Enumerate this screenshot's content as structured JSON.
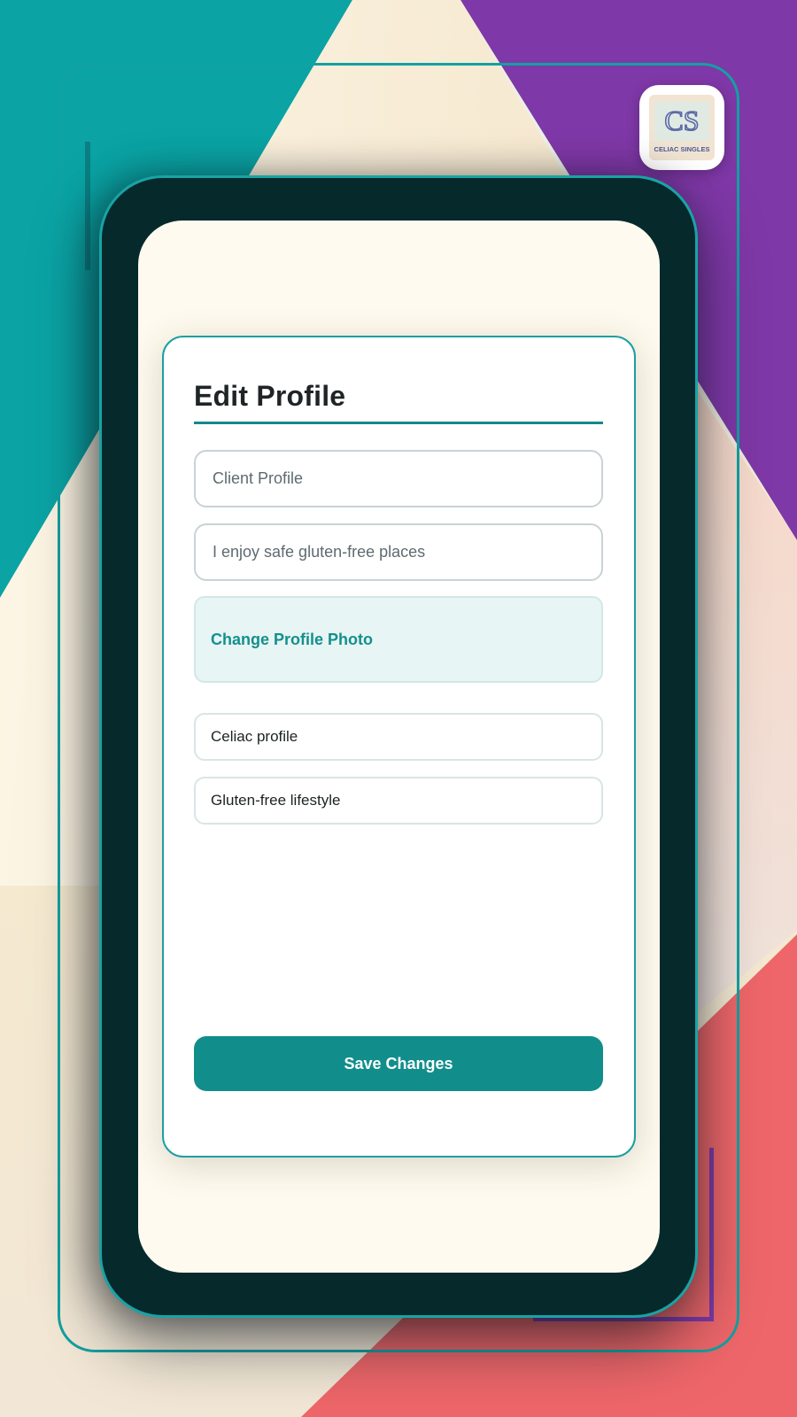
{
  "theme": {
    "teal": "#0ba3a4",
    "purple": "#7f38a7",
    "coral": "#ee6669",
    "phone_body": "#06292c",
    "screen_bg": "#fefaef",
    "accent": "#118e8b"
  },
  "logo": {
    "icon": "celiac-singles-logo",
    "monogram": "CS",
    "text": "CELIAC SINGLES"
  },
  "form": {
    "title": "Edit Profile",
    "name_field": {
      "value": "",
      "placeholder": "Client Profile"
    },
    "bio_field": {
      "value": "",
      "placeholder": "I enjoy safe gluten-free places"
    },
    "photo_button_label": "Change Profile Photo",
    "tags": [
      "Celiac profile",
      "Gluten-free lifestyle"
    ],
    "save_label": "Save Changes"
  }
}
